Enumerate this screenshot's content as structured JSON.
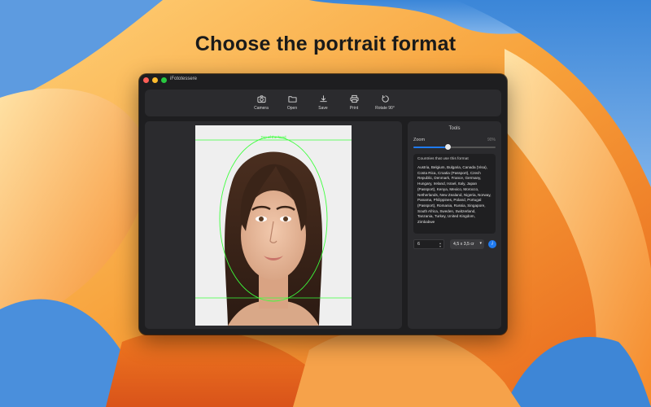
{
  "headline": "Choose the portrait format",
  "window": {
    "title": "iFototessere"
  },
  "toolbar": {
    "camera_label": "Camera",
    "open_label": "Open",
    "save_label": "Save",
    "print_label": "Print",
    "rotate_label": "Rotate 90°"
  },
  "preview": {
    "guide_label": "Top of the head"
  },
  "tools": {
    "title": "Tools",
    "zoom_label": "Zoom",
    "zoom_value": "90%",
    "zoom_fraction": 0.42,
    "countries_heading": "Countries that use this format",
    "countries_list": "Austria, Belgium, Bulgaria, Canada (Visa), Costa Rica, Croatia (Passport), Czech Republic, Denmark, France, Germany, Hungary, Ireland, Israel, Italy, Japan (Passport), Kenya, Mexico, Morocco, Netherlands, New Zealand, Nigeria, Norway, Panama, Philippines, Poland, Portugal (Passport), Romania, Russia, Singapore, South Africa, Sweden, Switzerland, Tanzania, Turkey, United Kingdom, Zimbabwe",
    "copies_value": "6",
    "format_value": "4,5 x 3,5 cr",
    "info_label": "i"
  },
  "colors": {
    "accent": "#1f7aef",
    "guide": "#3cff3c",
    "window_bg": "#1e1e20"
  }
}
